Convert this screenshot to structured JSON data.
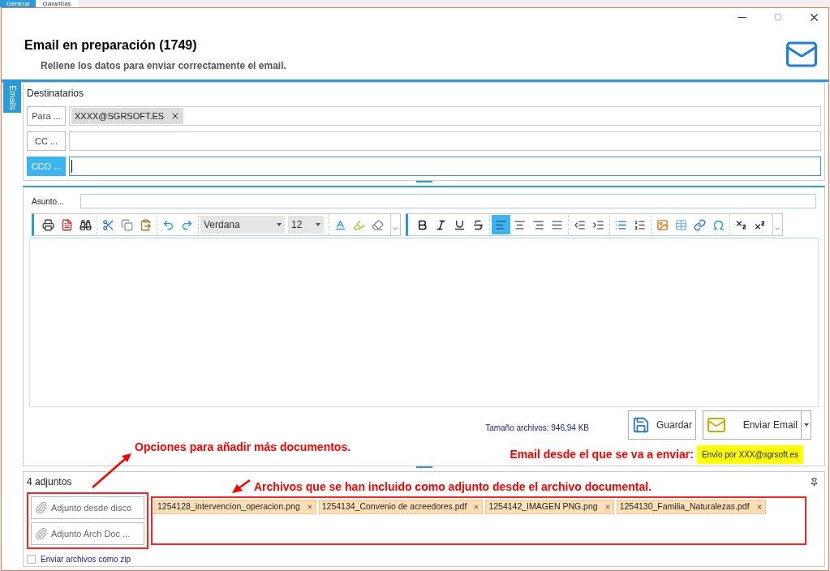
{
  "background_tabs": [
    {
      "label": "General",
      "selected": true
    },
    {
      "label": "Garantías",
      "selected": false
    }
  ],
  "window": {
    "title": "Email en preparación (1749)",
    "subtitle": "Rellene los datos para enviar correctamente el email."
  },
  "side_tab": {
    "label": "Emails"
  },
  "recipients": {
    "title": "Destinatarios",
    "rows": [
      {
        "button": "Para ...",
        "selected": false,
        "chips": [
          "XXXX@SGRSOFT.ES"
        ]
      },
      {
        "button": "CC ...",
        "selected": false
      },
      {
        "button": "CCO ...",
        "selected": true
      }
    ]
  },
  "subject": {
    "label": "Asunto..."
  },
  "toolbar": {
    "groups": [
      [
        {
          "kind": "print"
        },
        {
          "kind": "pdf"
        },
        {
          "kind": "find"
        }
      ],
      [
        {
          "kind": "cut"
        },
        {
          "kind": "copy"
        },
        {
          "kind": "paste"
        }
      ],
      [
        {
          "kind": "undo"
        },
        {
          "kind": "redo"
        }
      ],
      [
        {
          "kind": "font",
          "value": "Verdana"
        },
        {
          "kind": "size",
          "value": "12"
        }
      ],
      [
        {
          "kind": "font-color"
        },
        {
          "kind": "highlight"
        },
        {
          "kind": "eraser"
        },
        {
          "kind": "more"
        }
      ],
      [
        {
          "kind": "bold"
        },
        {
          "kind": "italic"
        },
        {
          "kind": "underline"
        },
        {
          "kind": "strike"
        }
      ],
      [
        {
          "kind": "align-left",
          "selected": true
        },
        {
          "kind": "align-center",
          "selected": false
        },
        {
          "kind": "align-right",
          "selected": false
        },
        {
          "kind": "justify",
          "selected": false
        }
      ],
      [
        {
          "kind": "outdent"
        },
        {
          "kind": "indent"
        }
      ],
      [
        {
          "kind": "bullets"
        },
        {
          "kind": "numbering"
        }
      ],
      [
        {
          "kind": "image"
        },
        {
          "kind": "table"
        },
        {
          "kind": "link"
        },
        {
          "kind": "symbol"
        }
      ],
      [
        {
          "kind": "subscript"
        },
        {
          "kind": "superscript"
        },
        {
          "kind": "more"
        }
      ]
    ]
  },
  "footer": {
    "size_label": "Tamaño archivos: 946,94 KB",
    "save": "Guardar",
    "send": "Enviar Email",
    "sender_annotation": "Email desde el que se va a enviar:",
    "sender": "Envío por XXX@sgrsoft.es"
  },
  "attachments": {
    "count": "4 adjuntos",
    "annotation_left": "Opciones para añadir más documentos.",
    "annotation_right": "Archivos que se han incluido como adjunto desde el archivo documental.",
    "buttons": [
      "Adjunto desde disco",
      "Adjunto Arch Doc ..."
    ],
    "files": [
      "1254128_intervencion_operacion.png",
      "1254134_Convenio de acreedores.pdf",
      "1254142_IMAGEN PNG.png",
      "1254130_Familia_Naturalezas.pdf"
    ],
    "zip": {
      "label": "Enviar archivos como zip",
      "checked": false
    }
  }
}
